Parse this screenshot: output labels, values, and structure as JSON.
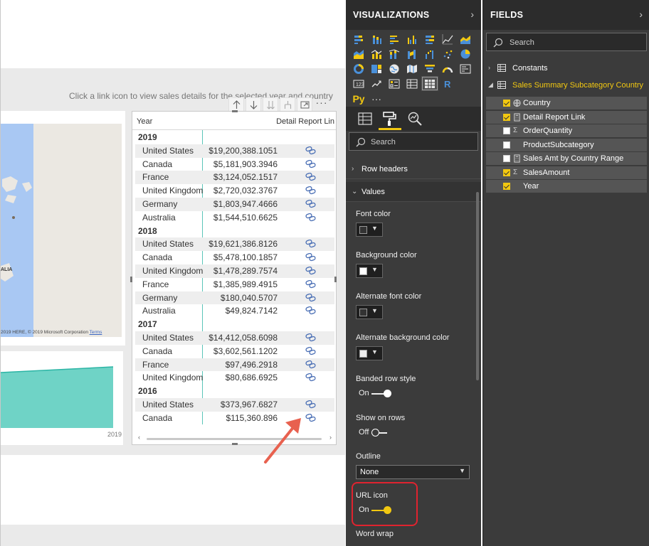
{
  "canvas": {
    "hint": "Click a link icon to view sales details for the selected year and country",
    "map": {
      "label": "ALIA",
      "copyright": "2019 HERE, © 2019 Microsoft Corporation",
      "terms": "Terms"
    },
    "area_chart": {
      "x_label": "2019"
    },
    "table": {
      "headers": {
        "year": "Year",
        "link": "Detail Report Lin"
      },
      "groups": [
        {
          "year": "2019",
          "rows": [
            {
              "country": "United States",
              "amount": "$19,200,388.1051"
            },
            {
              "country": "Canada",
              "amount": "$5,181,903.3946"
            },
            {
              "country": "France",
              "amount": "$3,124,052.1517"
            },
            {
              "country": "United Kingdom",
              "amount": "$2,720,032.3767"
            },
            {
              "country": "Germany",
              "amount": "$1,803,947.4666"
            },
            {
              "country": "Australia",
              "amount": "$1,544,510.6625"
            }
          ]
        },
        {
          "year": "2018",
          "rows": [
            {
              "country": "United States",
              "amount": "$19,621,386.8126"
            },
            {
              "country": "Canada",
              "amount": "$5,478,100.1857"
            },
            {
              "country": "United Kingdom",
              "amount": "$1,478,289.7574"
            },
            {
              "country": "France",
              "amount": "$1,385,989.4915"
            },
            {
              "country": "Germany",
              "amount": "$180,040.5707"
            },
            {
              "country": "Australia",
              "amount": "$49,824.7142"
            }
          ]
        },
        {
          "year": "2017",
          "rows": [
            {
              "country": "United States",
              "amount": "$14,412,058.6098"
            },
            {
              "country": "Canada",
              "amount": "$3,602,561.1202"
            },
            {
              "country": "France",
              "amount": "$97,496.2918"
            },
            {
              "country": "United Kingdom",
              "amount": "$80,686.6925"
            }
          ]
        },
        {
          "year": "2016",
          "rows": [
            {
              "country": "United States",
              "amount": "$373,967.6827"
            },
            {
              "country": "Canada",
              "amount": "$115,360.896"
            }
          ]
        }
      ]
    }
  },
  "visualizations": {
    "title": "VISUALIZATIONS",
    "py_label": "Py",
    "more_label": "···",
    "search_placeholder": "Search",
    "sections": {
      "row_headers": "Row headers",
      "values": "Values"
    },
    "properties": {
      "font_color": "Font color",
      "background_color": "Background color",
      "alternate_font_color": "Alternate font color",
      "alternate_background_color": "Alternate background color",
      "banded_row_style": "Banded row style",
      "banded_row_style_state": "On",
      "show_on_rows": "Show on rows",
      "show_on_rows_state": "Off",
      "outline": "Outline",
      "outline_value": "None",
      "url_icon": "URL icon",
      "url_icon_state": "On",
      "word_wrap": "Word wrap"
    },
    "colors": {
      "font_color": "#333333",
      "background_color": "#ffffff",
      "alternate_font_color": "#333333",
      "alternate_background_color": "#eeeeee",
      "accent": "#f2c811",
      "highlight": "#e0232f"
    }
  },
  "fields": {
    "title": "FIELDS",
    "search_placeholder": "Search",
    "tables": [
      {
        "name": "Constants",
        "expanded": false
      },
      {
        "name": "Sales Summary Subcategory Country",
        "expanded": true,
        "fields": [
          {
            "name": "Country",
            "checked": true,
            "icon": "globe-icon"
          },
          {
            "name": "Detail Report Link",
            "checked": true,
            "icon": "calc-icon"
          },
          {
            "name": "OrderQuantity",
            "checked": false,
            "icon": "sigma-icon"
          },
          {
            "name": "ProductSubcategory",
            "checked": false,
            "icon": ""
          },
          {
            "name": "Sales Amt by Country Range",
            "checked": false,
            "icon": "calc-icon"
          },
          {
            "name": "SalesAmount",
            "checked": true,
            "icon": "sigma-icon"
          },
          {
            "name": "Year",
            "checked": true,
            "icon": ""
          }
        ]
      }
    ]
  }
}
